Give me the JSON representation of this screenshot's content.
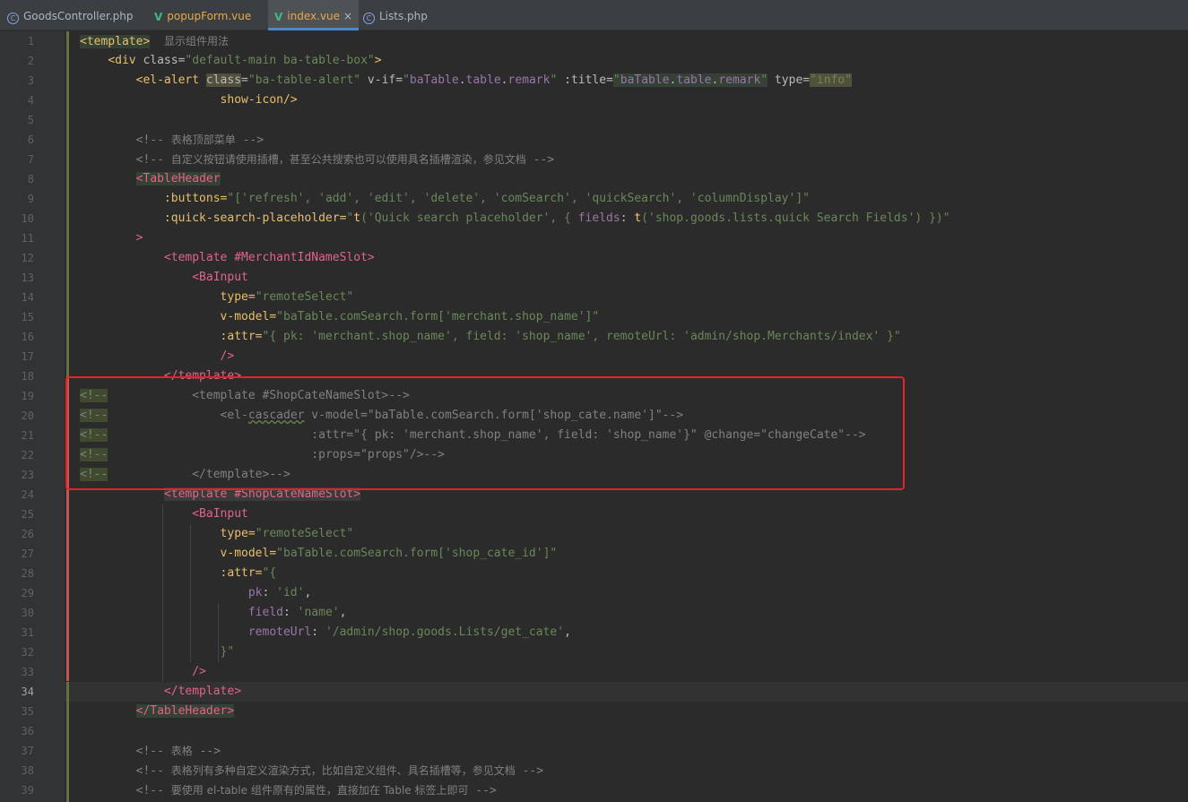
{
  "tabs": [
    {
      "label": "GoodsController.php",
      "type": "php"
    },
    {
      "label": "popupForm.vue",
      "type": "vue"
    },
    {
      "label": "index.vue",
      "type": "vue",
      "active": true
    },
    {
      "label": "Lists.php",
      "type": "php"
    }
  ],
  "tab_close": "×",
  "line_numbers": [
    "1",
    "2",
    "3",
    "4",
    "5",
    "6",
    "7",
    "8",
    "9",
    "10",
    "11",
    "12",
    "13",
    "14",
    "15",
    "16",
    "17",
    "18",
    "19",
    "20",
    "21",
    "22",
    "23",
    "24",
    "25",
    "26",
    "27",
    "28",
    "29",
    "30",
    "31",
    "32",
    "33",
    "34",
    "35",
    "36",
    "37",
    "38",
    "39"
  ],
  "current_line": "34",
  "hint": "显示组件用法",
  "code": {
    "l1_tag": "<template>",
    "l2_tag": "<div",
    "l2_attr": " class=",
    "l2_val": "\"default-main ba-table-box\"",
    "l2_end": ">",
    "l3_tag": "<el-alert",
    "l3_a1": "class",
    "l3_a1eq": "=",
    "l3_v1": "\"ba-table-alert\"",
    "l3_a2": " v-if=",
    "l3_v2a": "\"",
    "l3_v2b": "baTable",
    "l3_v2c": ".",
    "l3_v2d": "table",
    "l3_v2e": ".",
    "l3_v2f": "remark",
    "l3_v2g": "\"",
    "l3_a3": " :title=",
    "l3_v3a": "\"",
    "l3_v3b": "baTable",
    "l3_v3c": ".",
    "l3_v3d": "table",
    "l3_v3e": ".",
    "l3_v3f": "remark",
    "l3_v3g": "\"",
    "l3_a4": " type=",
    "l3_v4": "\"info\"",
    "l4": "show-icon/>",
    "l6a": "<!-- ",
    "l6b": "表格顶部菜单",
    "l6c": " -->",
    "l7a": "<!-- ",
    "l7b": "自定义按钮请使用插槽，甚至公共搜索也可以使用具名插槽渲染，参见文档",
    "l7c": " -->",
    "l8": "<TableHeader",
    "l9a": ":buttons=",
    "l9b": "\"['refresh', 'add', 'edit', 'delete', 'comSearch', 'quickSearch', 'columnDisplay']\"",
    "l10a": ":quick-search-placeholder=",
    "l10b": "\"",
    "l10c": "t",
    "l10d": "('Quick search placeholder', { ",
    "l10e": "fields",
    "l10f": ": ",
    "l10g": "t",
    "l10h": "('shop.goods.lists.quick Search Fields') })\"",
    "l11": ">",
    "l12": "<template #MerchantIdNameSlot>",
    "l13": "<BaInput",
    "l14a": "type=",
    "l14b": "\"remoteSelect\"",
    "l15a": "v-model=",
    "l15b": "\"baTable.comSearch.form['merchant.shop_name']\"",
    "l16a": ":attr=",
    "l16b": "\"{ pk: 'merchant.shop_name', field: 'shop_name', remoteUrl: 'admin/shop.Merchants/index' }\"",
    "l17": "/>",
    "l18": "</template>",
    "cm_prefix": "<!--",
    "l19": "<template #ShopCateNameSlot>-->",
    "l20a": "<el-",
    "l20b": "cascader",
    "l20c": " v-model=\"baTable.comSearch.form['shop_cate.name']\"-->",
    "l21": ":attr=\"{ pk: 'merchant.shop_name', field: 'shop_name'}\" @change=\"changeCate\"-->",
    "l22": ":props=\"props\"/>-->",
    "l23": "</template>-->",
    "l24": "<template #ShopCateNameSlot>",
    "l25": "<BaInput",
    "l26a": "type=",
    "l26b": "\"remoteSelect\"",
    "l27a": "v-model=",
    "l27b": "\"baTable.comSearch.form['shop_cate_id']\"",
    "l28a": ":attr=",
    "l28b": "\"{",
    "l29a": "pk",
    "l29b": ": ",
    "l29c": "'id'",
    "l29d": ",",
    "l30a": "field",
    "l30b": ": ",
    "l30c": "'name'",
    "l30d": ",",
    "l31a": "remoteUrl",
    "l31b": ": ",
    "l31c": "'/admin/shop.goods.Lists/get_cate'",
    "l31d": ",",
    "l32": "}\"",
    "l33": "/>",
    "l34": "</template>",
    "l35": "</TableHeader>",
    "l37a": "<!-- ",
    "l37b": "表格",
    "l37c": " -->",
    "l38a": "<!-- ",
    "l38b": "表格列有多种自定义渲染方式，比如自定义组件、具名插槽等，参见文档",
    "l38c": " -->",
    "l39a": "<!-- ",
    "l39b": "要使用 el-table 组件原有的属性，直接加在 Table 标签上即可",
    "l39c": " -->"
  },
  "colors": {
    "background": "#2b2b2b",
    "gutter": "#313335",
    "tag": "#e8bf6a",
    "string": "#6a8759",
    "comment": "#808080",
    "highlight_box": "#e8202a"
  }
}
